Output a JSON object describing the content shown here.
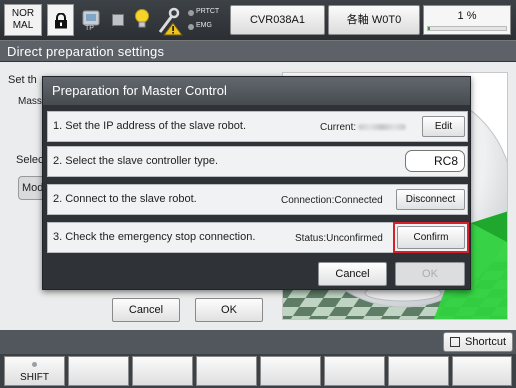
{
  "status_bar": {
    "mode_line1": "NOR",
    "mode_line2": "MAL",
    "tp_label": "TP",
    "prtct_label": "PRTCT",
    "emg_label": "EMG",
    "robot_name": "CVR038A1",
    "coord_label": "各軸 W0T0",
    "speed_text": "1 %",
    "speed_fraction": 0.01,
    "icons": [
      "lock-icon",
      "teach-pendant-icon",
      "stop-square-icon",
      "bulb-icon",
      "wrench-warning-icon"
    ]
  },
  "page": {
    "title": "Direct preparation settings",
    "bg_text_1": "Set th",
    "bg_text_2": "Mass",
    "bg_text_3": "Selec",
    "bg_segment": "Mod",
    "cancel_label": "Cancel",
    "ok_label": "OK"
  },
  "dialog": {
    "title": "Preparation for Master Control",
    "steps": [
      {
        "text": "1. Set the IP address of the slave robot.",
        "info": "Current:",
        "button": "Edit"
      },
      {
        "text": "2. Select the slave controller type.",
        "value": "RC8"
      },
      {
        "text": "2. Connect to the slave robot.",
        "info": "Connection:Connected",
        "button": "Disconnect"
      },
      {
        "text": "3. Check the emergency stop connection.",
        "info": "Status:Unconfirmed",
        "button": "Confirm"
      }
    ],
    "cancel_label": "Cancel",
    "ok_label": "OK"
  },
  "bottom": {
    "shortcut_label": "Shortcut",
    "shift_label": "SHIFT"
  },
  "colors": {
    "highlight": "#d6202a",
    "speed_fill": "#3aa043",
    "floor_dark": "#5f7d66",
    "floor_light": "#bfd4c3",
    "grass": "#2fd23e"
  }
}
